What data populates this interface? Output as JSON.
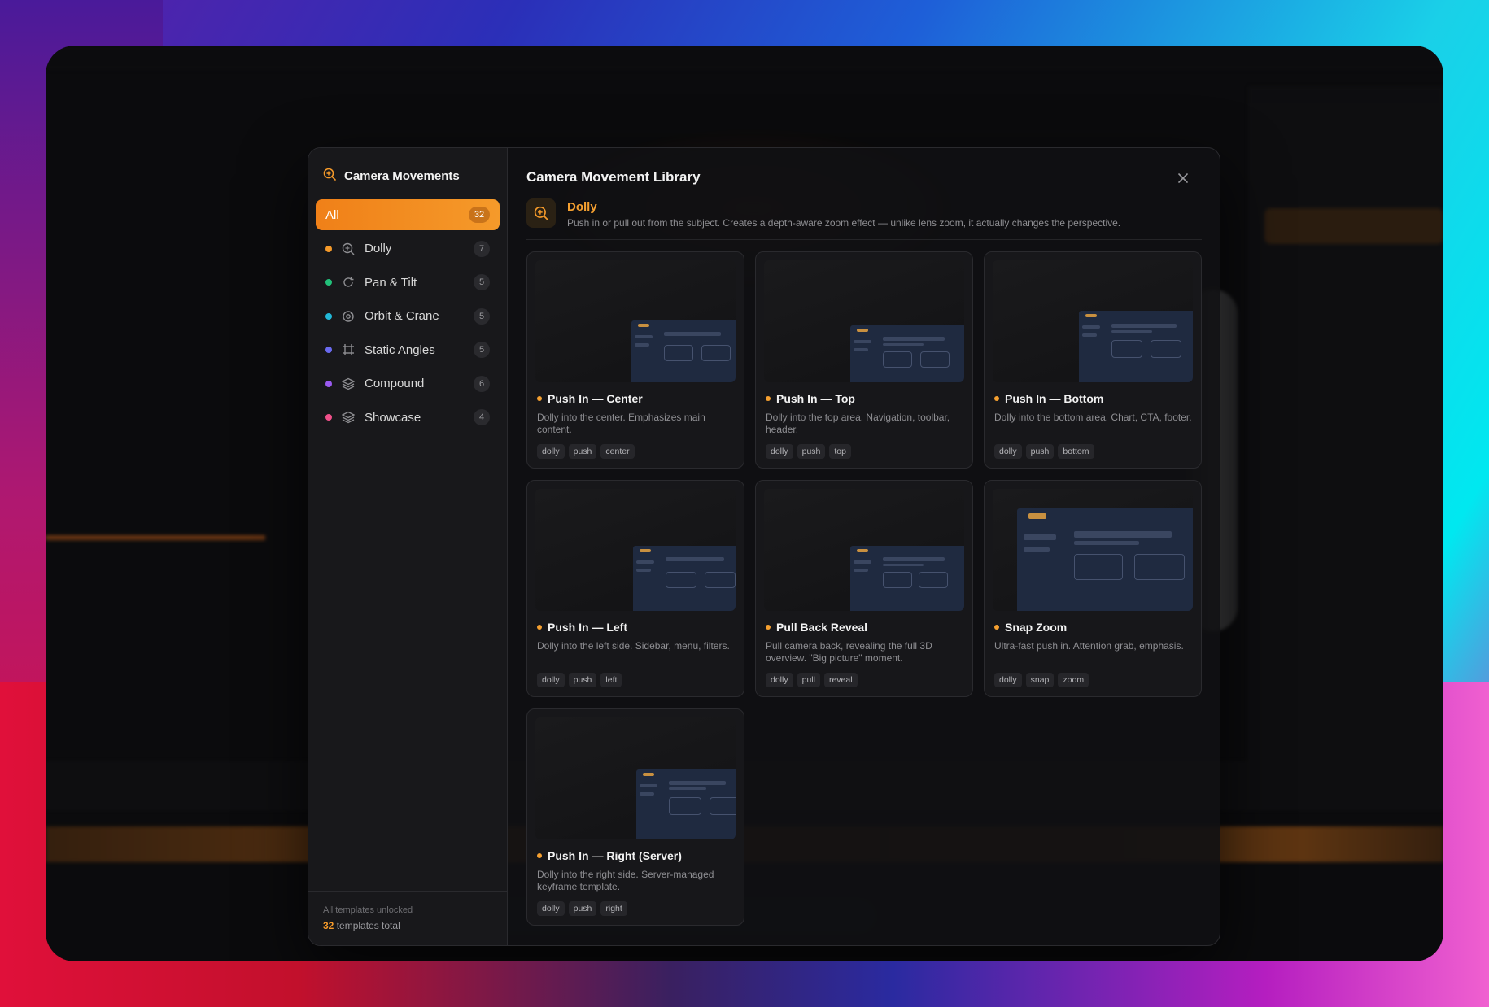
{
  "sidebar": {
    "title": "Camera Movements",
    "categories": [
      {
        "label": "All",
        "count": "32",
        "active": true
      },
      {
        "label": "Dolly",
        "count": "7",
        "dot": "#f59a2a",
        "icon": "zoom-icon"
      },
      {
        "label": "Pan & Tilt",
        "count": "5",
        "dot": "#22c07a",
        "icon": "rotate-icon"
      },
      {
        "label": "Orbit & Crane",
        "count": "5",
        "dot": "#22b8d8",
        "icon": "orbit-icon"
      },
      {
        "label": "Static Angles",
        "count": "5",
        "dot": "#6a6af0",
        "icon": "frame-icon"
      },
      {
        "label": "Compound",
        "count": "6",
        "dot": "#9a5af0",
        "icon": "layers-icon"
      },
      {
        "label": "Showcase",
        "count": "4",
        "dot": "#f0508a",
        "icon": "layers-icon"
      }
    ],
    "footer": {
      "line1": "All templates unlocked",
      "count": "32",
      "line2_suffix": " templates total"
    }
  },
  "main": {
    "title": "Camera Movement Library",
    "section": {
      "name": "Dolly",
      "description": "Push in or pull out from the subject. Creates a depth-aware zoom effect — unlike lens zoom, it actually changes the perspective."
    },
    "cards": [
      {
        "title": "Push In — Center",
        "desc": "Dolly into the center. Emphasizes main content.",
        "tags": [
          "dolly",
          "push",
          "center"
        ]
      },
      {
        "title": "Push In — Top",
        "desc": "Dolly into the top area. Navigation, toolbar, header.",
        "tags": [
          "dolly",
          "push",
          "top"
        ]
      },
      {
        "title": "Push In — Bottom",
        "desc": "Dolly into the bottom area. Chart, CTA, footer.",
        "tags": [
          "dolly",
          "push",
          "bottom"
        ]
      },
      {
        "title": "Push In — Left",
        "desc": "Dolly into the left side. Sidebar, menu, filters.",
        "tags": [
          "dolly",
          "push",
          "left"
        ]
      },
      {
        "title": "Pull Back Reveal",
        "desc": "Pull camera back, revealing the full 3D overview. \"Big picture\" moment.",
        "tags": [
          "dolly",
          "pull",
          "reveal"
        ]
      },
      {
        "title": "Snap Zoom",
        "desc": "Ultra-fast push in. Attention grab, emphasis.",
        "tags": [
          "dolly",
          "snap",
          "zoom"
        ]
      },
      {
        "title": "Push In — Right (Server)",
        "desc": "Dolly into the right side. Server-managed keyframe template.",
        "tags": [
          "dolly",
          "push",
          "right"
        ]
      }
    ]
  },
  "colors": {
    "accent": "#f59a2a"
  }
}
